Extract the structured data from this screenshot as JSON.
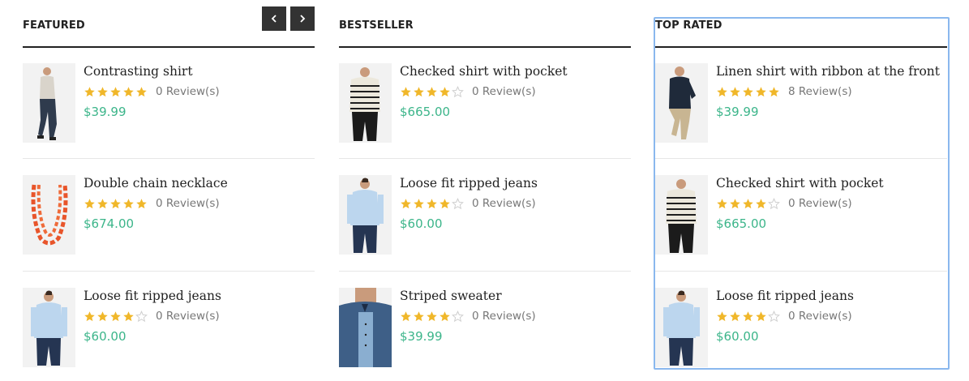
{
  "columns": [
    {
      "title": "FEATURED",
      "has_nav": true,
      "items": [
        {
          "name": "Contrasting shirt",
          "rating": 5,
          "reviews": "0 Review(s)",
          "price": "$39.99",
          "thumb": "man-grey-jeans"
        },
        {
          "name": "Double chain necklace",
          "rating": 5,
          "reviews": "0 Review(s)",
          "price": "$674.00",
          "thumb": "orange-necklace"
        },
        {
          "name": "Loose fit ripped jeans",
          "rating": 4,
          "reviews": "0 Review(s)",
          "price": "$60.00",
          "thumb": "man-light-blue-shirt"
        }
      ]
    },
    {
      "title": "BESTSELLER",
      "has_nav": false,
      "items": [
        {
          "name": "Checked shirt with pocket",
          "rating": 4,
          "reviews": "0 Review(s)",
          "price": "$665.00",
          "thumb": "man-striped-sweater"
        },
        {
          "name": "Loose fit ripped jeans",
          "rating": 4,
          "reviews": "0 Review(s)",
          "price": "$60.00",
          "thumb": "man-light-blue-shirt"
        },
        {
          "name": "Striped sweater",
          "rating": 4,
          "reviews": "0 Review(s)",
          "price": "$39.99",
          "thumb": "man-denim-patchwork"
        }
      ]
    },
    {
      "title": "TOP RATED",
      "has_nav": false,
      "items": [
        {
          "name": "Linen shirt with ribbon at the front",
          "rating": 5,
          "reviews": "8 Review(s)",
          "price": "$39.99",
          "thumb": "man-dark-shirt-beige"
        },
        {
          "name": "Checked shirt with pocket",
          "rating": 4,
          "reviews": "0 Review(s)",
          "price": "$665.00",
          "thumb": "man-striped-sweater"
        },
        {
          "name": "Loose fit ripped jeans",
          "rating": 4,
          "reviews": "0 Review(s)",
          "price": "$60.00",
          "thumb": "man-light-blue-shirt"
        }
      ]
    }
  ],
  "nav": {
    "prev_icon": "chevron-left-icon",
    "next_icon": "chevron-right-icon"
  },
  "colors": {
    "price": "#3cb58a",
    "star_filled": "#f0b72a",
    "star_empty": "#cfcfcf",
    "heading": "#222222",
    "nav_bg": "#333333",
    "focus": "#8ab8ee"
  }
}
